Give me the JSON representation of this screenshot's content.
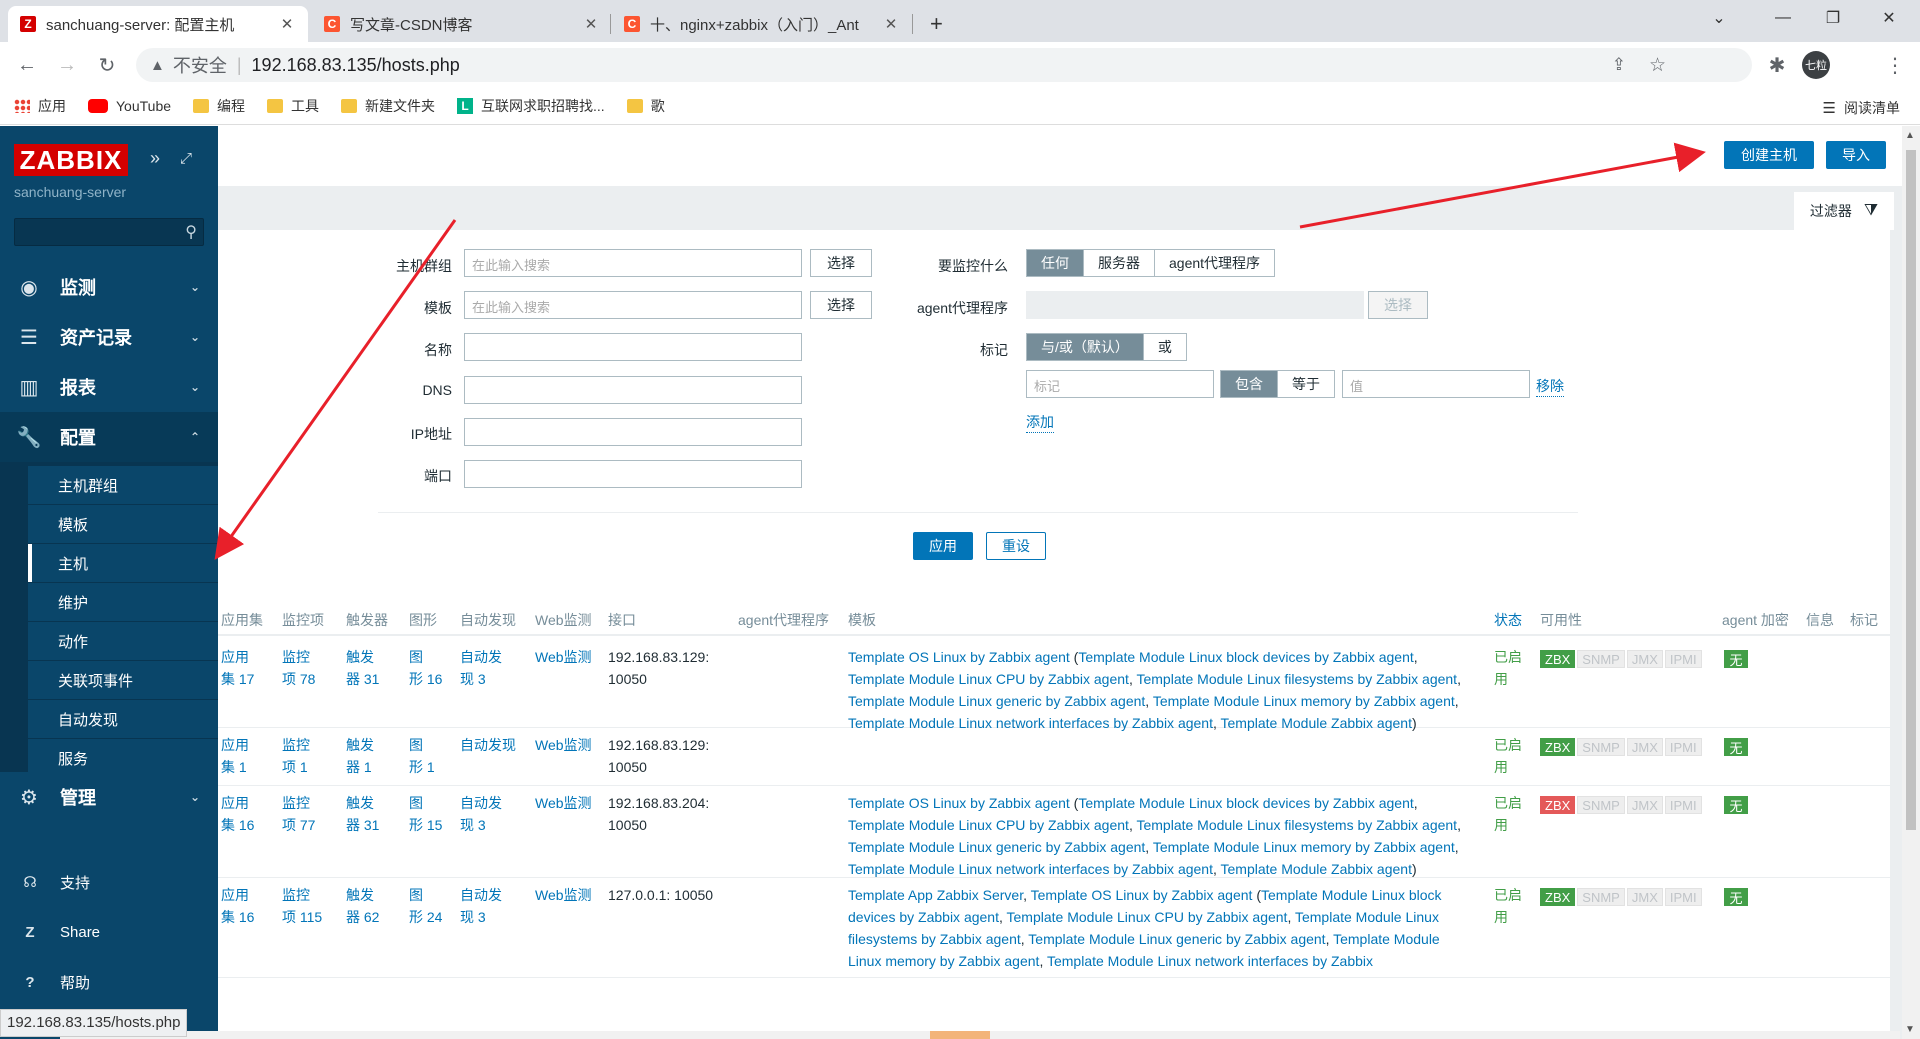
{
  "browser": {
    "tabs": [
      {
        "title": "sanchuang-server: 配置主机",
        "favicon": "Z",
        "favicon_color": "#d40000"
      },
      {
        "title": "写文章-CSDN博客",
        "favicon": "C",
        "favicon_color": "#fc5531"
      },
      {
        "title": "十、nginx+zabbix（入门）_Ant",
        "favicon": "C",
        "favicon_color": "#fc5531"
      }
    ],
    "security_label": "不安全",
    "url": "192.168.83.135/hosts.php",
    "profile": "七粒",
    "bookmarks": [
      {
        "label": "应用",
        "icon": "apps-icon"
      },
      {
        "label": "YouTube",
        "icon": "youtube-icon"
      },
      {
        "label": "编程",
        "icon": "folder-icon"
      },
      {
        "label": "工具",
        "icon": "folder-icon"
      },
      {
        "label": "新建文件夹",
        "icon": "folder-icon"
      },
      {
        "label": "互联网求职招聘找...",
        "icon": "lagou-icon"
      },
      {
        "label": "歌",
        "icon": "folder-icon"
      }
    ],
    "reading_list": "阅读清单",
    "status_url": "192.168.83.135/hosts.php"
  },
  "sidebar": {
    "logo": "ZABBIX",
    "server_name": "sanchuang-server",
    "menu": [
      {
        "label": "监测",
        "icon": "eye-icon"
      },
      {
        "label": "资产记录",
        "icon": "list-icon"
      },
      {
        "label": "报表",
        "icon": "bar-chart-icon"
      },
      {
        "label": "配置",
        "icon": "wrench-icon"
      },
      {
        "label": "管理",
        "icon": "gear-icon"
      }
    ],
    "submenu": [
      "主机群组",
      "模板",
      "主机",
      "维护",
      "动作",
      "关联项事件",
      "自动发现",
      "服务"
    ],
    "bottom": [
      {
        "label": "支持",
        "icon": "headset-icon"
      },
      {
        "label": "Share",
        "icon": "share-icon"
      },
      {
        "label": "帮助",
        "icon": "help-icon"
      }
    ]
  },
  "header": {
    "create_host": "创建主机",
    "import": "导入",
    "filter_tab": "过滤器"
  },
  "filter": {
    "host_group_label": "主机群组",
    "template_label": "模板",
    "name_label": "名称",
    "dns_label": "DNS",
    "ip_label": "IP地址",
    "port_label": "端口",
    "search_placeholder": "在此输入搜索",
    "select": "选择",
    "monitored_by_label": "要监控什么",
    "monitored_by_options": [
      "任何",
      "服务器",
      "agent代理程序"
    ],
    "proxy_label": "agent代理程序",
    "tags_label": "标记",
    "tags_mode_options": [
      "与/或（默认）",
      "或"
    ],
    "tag_placeholder": "标记",
    "tag_op_options": [
      "包含",
      "等于"
    ],
    "value_placeholder": "值",
    "remove": "移除",
    "add": "添加",
    "apply": "应用",
    "reset": "重设"
  },
  "table": {
    "headers": [
      "应用集",
      "监控项",
      "触发器",
      "图形",
      "自动发现",
      "Web监测",
      "接口",
      "agent代理程序",
      "模板",
      "状态",
      "可用性",
      "agent 加密",
      "信息",
      "标记"
    ],
    "rows": [
      {
        "apps": [
          "应用",
          "集 17"
        ],
        "items": [
          "监控",
          "项 78"
        ],
        "triggers": [
          "触发",
          "器 31"
        ],
        "graphs": [
          "图",
          "形 16"
        ],
        "discovery": [
          "自动发",
          "现 3"
        ],
        "web": "Web监测",
        "interface": [
          "192.168.83.129:",
          "10050"
        ],
        "templates": [
          "Template OS Linux by Zabbix agent",
          " (",
          "Template Module Linux block devices by Zabbix agent",
          ", ",
          "Template Module Linux CPU by Zabbix agent",
          ", ",
          "Template Module Linux filesystems by Zabbix agent",
          ", ",
          "Template Module Linux generic by Zabbix agent",
          ", ",
          "Template Module Linux memory by Zabbix agent",
          ", ",
          "Template Module Linux network interfaces by Zabbix agent",
          ", ",
          "Template Module Zabbix agent",
          ")"
        ],
        "status": [
          "已启",
          "用"
        ],
        "zbx_color": "#429e47",
        "encryption": "无"
      },
      {
        "apps": [
          "应用",
          "集 1"
        ],
        "items": [
          "监控",
          "项 1"
        ],
        "triggers": [
          "触发",
          "器 1"
        ],
        "graphs": [
          "图",
          "形 1"
        ],
        "discovery": [
          "自动发现",
          ""
        ],
        "web": "Web监测",
        "interface": [
          "192.168.83.129:",
          "10050"
        ],
        "templates": [],
        "status": [
          "已启",
          "用"
        ],
        "zbx_color": "#429e47",
        "encryption": "无"
      },
      {
        "apps": [
          "应用",
          "集 16"
        ],
        "items": [
          "监控",
          "项 77"
        ],
        "triggers": [
          "触发",
          "器 31"
        ],
        "graphs": [
          "图",
          "形 15"
        ],
        "discovery": [
          "自动发",
          "现 3"
        ],
        "web": "Web监测",
        "interface": [
          "192.168.83.204:",
          "10050"
        ],
        "templates": [
          "Template OS Linux by Zabbix agent",
          " (",
          "Template Module Linux block devices by Zabbix agent",
          ", ",
          "Template Module Linux CPU by Zabbix agent",
          ", ",
          "Template Module Linux filesystems by Zabbix agent",
          ", ",
          "Template Module Linux generic by Zabbix agent",
          ", ",
          "Template Module Linux memory by Zabbix agent",
          ", ",
          "Template Module Linux network interfaces by Zabbix agent",
          ", ",
          "Template Module Zabbix agent",
          ")"
        ],
        "status": [
          "已启",
          "用"
        ],
        "zbx_color": "#e45959",
        "encryption": "无"
      },
      {
        "apps": [
          "应用",
          "集 16"
        ],
        "items": [
          "监控",
          "项 115"
        ],
        "triggers": [
          "触发",
          "器 62"
        ],
        "graphs": [
          "图",
          "形 24"
        ],
        "discovery": [
          "自动发",
          "现 3"
        ],
        "web": "Web监测",
        "interface": [
          "127.0.0.1: 10050",
          ""
        ],
        "templates": [
          "Template App Zabbix Server",
          ", ",
          "Template OS Linux by Zabbix agent",
          " (",
          "Template Module Linux block devices by Zabbix agent",
          ", ",
          "Template Module Linux CPU by Zabbix agent",
          ", ",
          "Template Module Linux filesystems by Zabbix agent",
          ", ",
          "Template Module Linux generic by Zabbix agent",
          ", ",
          "Template Module Linux memory by Zabbix agent",
          ", ",
          "Template Module Linux network interfaces by Zabbix"
        ],
        "status": [
          "已启",
          "用"
        ],
        "zbx_color": "#429e47",
        "encryption": "无"
      }
    ],
    "availability": [
      "ZBX",
      "SNMP",
      "JMX",
      "IPMI"
    ]
  },
  "annotations": {
    "arrow_color": "#e8202a"
  }
}
